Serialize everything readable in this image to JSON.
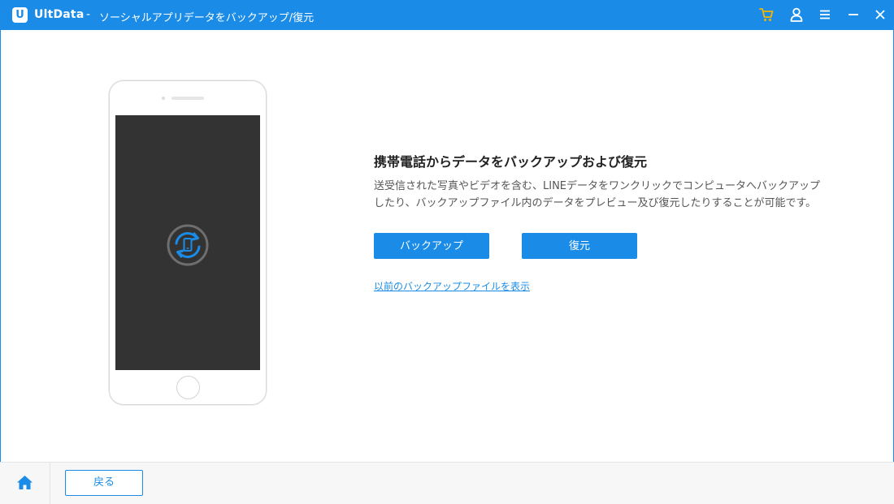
{
  "window": {
    "logo_glyph": "U",
    "app_name": "UltData",
    "separator": "-",
    "title": "ソーシャルアプリデータをバックアップ/復元"
  },
  "titlebar_icons": [
    "cart-icon",
    "user-icon",
    "menu-icon",
    "minimize-icon",
    "close-icon"
  ],
  "main": {
    "heading": "携帯電話からデータをバックアップおよび復元",
    "description_lines": [
      "送受信された写真やビデオを含む、LINEデータをワンクリックでコンピュータへバックアップ",
      "したり、バックアップファイル内のデータをプレビュー及び復元したりすることが可能です。"
    ],
    "backup_button": "バックアップ",
    "restore_button": "復元",
    "view_backups_link": "以前のバックアップファイルを表示"
  },
  "bottom": {
    "back_button": "戻る"
  },
  "colors": {
    "accent": "#1a8ce8",
    "cart": "#f5b400",
    "phone_screen": "#333333"
  }
}
